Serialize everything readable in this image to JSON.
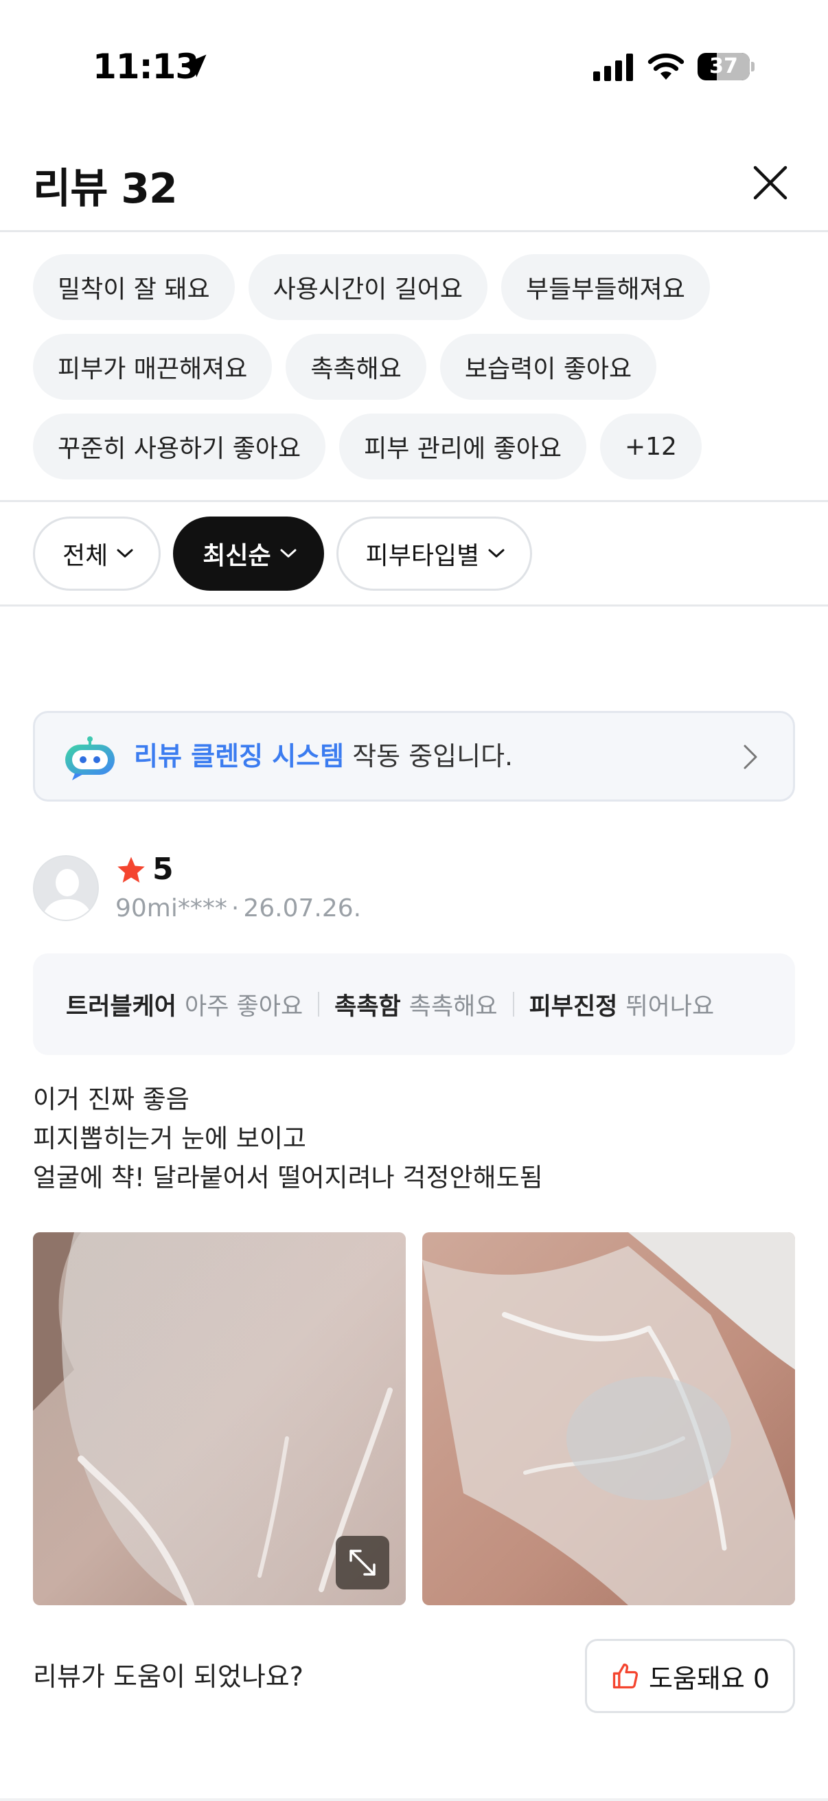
{
  "status_bar": {
    "time": "11:13",
    "battery": "37",
    "battery_level": 0.37,
    "icons": [
      "location-arrow-icon",
      "signal-icon",
      "wifi-icon",
      "battery-icon"
    ]
  },
  "header": {
    "title": "리뷰 32",
    "close_icon": "close-icon"
  },
  "keywords": [
    "밀착이 잘 돼요",
    "사용시간이 길어요",
    "부들부들해져요",
    "피부가 매끈해져요",
    "촉촉해요",
    "보습력이 좋아요",
    "꾸준히 사용하기 좋아요",
    "피부 관리에 좋아요",
    "+12"
  ],
  "filters": {
    "all": "전체",
    "sort": "최신순",
    "skin_type": "피부타입별",
    "active": "sort"
  },
  "banner": {
    "highlight": "리뷰 클렌징 시스템",
    "rest": " 작동 중입니다.",
    "icon": "robot-icon"
  },
  "review": {
    "rating": "5",
    "user": "90mi****",
    "separator": "·",
    "date": "26.07.26.",
    "attributes": [
      {
        "key": "트러블케어",
        "value": "아주 좋아요"
      },
      {
        "key": "촉촉함",
        "value": "촉촉해요"
      },
      {
        "key": "피부진정",
        "value": "뛰어나요"
      }
    ],
    "text_lines": [
      "이거 진짜 좋음",
      "피지뽑히는거 눈에 보이고",
      "얼굴에 챡! 달라붙어서 떨어지려나 걱정안해도됨"
    ],
    "helpful_question": "리뷰가 도움이 되었나요?",
    "helpful_label": "도움돼요 0"
  },
  "colors": {
    "accent_blue": "#3b7cf0",
    "star_red": "#f4452f",
    "chip_bg": "#f2f4f6",
    "active_filter": "#111111"
  }
}
